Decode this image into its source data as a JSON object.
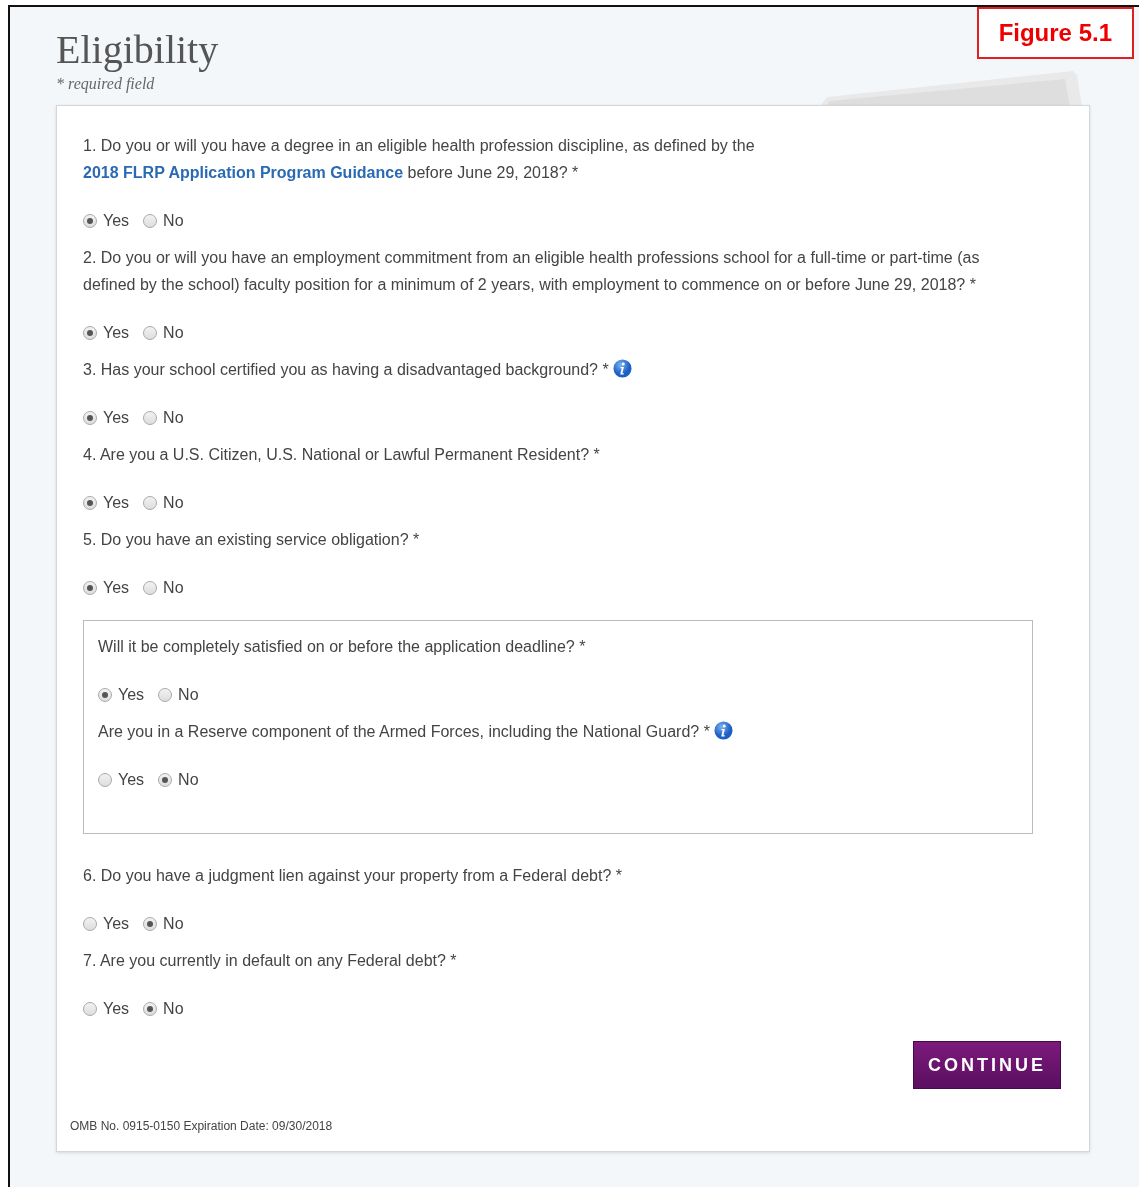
{
  "figure_label": "Figure 5.1",
  "heading": "Eligibility",
  "required_note": "* required field",
  "questions": [
    {
      "text_before": "1. Do you or will you have a degree in an eligible health profession discipline, as defined by the ",
      "link": "2018 FLRP Application Program Guidance",
      "text_after": " before June 29, 2018? *",
      "info": false,
      "options": [
        {
          "label": "Yes",
          "selected": true
        },
        {
          "label": "No",
          "selected": false
        }
      ]
    },
    {
      "text_before": "2. Do you or will you have an employment commitment from an eligible health professions school for a full-time or part-time (as defined by the school) faculty position for a minimum of 2 years, with employment to commence on or before June 29, 2018? *",
      "info": false,
      "options": [
        {
          "label": "Yes",
          "selected": true
        },
        {
          "label": "No",
          "selected": false
        }
      ]
    },
    {
      "text_before": "3. Has your school certified you as having a disadvantaged background? *",
      "info": true,
      "options": [
        {
          "label": "Yes",
          "selected": true
        },
        {
          "label": "No",
          "selected": false
        }
      ]
    },
    {
      "text_before": "4. Are you a U.S. Citizen, U.S. National or Lawful Permanent Resident? *",
      "info": false,
      "options": [
        {
          "label": "Yes",
          "selected": true
        },
        {
          "label": "No",
          "selected": false
        }
      ]
    },
    {
      "text_before": "5. Do you have an existing service obligation? *",
      "info": false,
      "options": [
        {
          "label": "Yes",
          "selected": true
        },
        {
          "label": "No",
          "selected": false
        }
      ],
      "followups": [
        {
          "text_before": "Will it be completely satisfied on or before the application deadline? *",
          "info": false,
          "options": [
            {
              "label": "Yes",
              "selected": true
            },
            {
              "label": "No",
              "selected": false
            }
          ]
        },
        {
          "text_before": "Are you in a Reserve component of the Armed Forces, including the National Guard? *",
          "info": true,
          "options": [
            {
              "label": "Yes",
              "selected": false
            },
            {
              "label": "No",
              "selected": true
            }
          ]
        }
      ]
    },
    {
      "text_before": "6. Do you have a judgment lien against your property from a Federal debt? *",
      "info": false,
      "options": [
        {
          "label": "Yes",
          "selected": false
        },
        {
          "label": "No",
          "selected": true
        }
      ]
    },
    {
      "text_before": "7. Are you currently in default on any Federal debt? *",
      "info": false,
      "options": [
        {
          "label": "Yes",
          "selected": false
        },
        {
          "label": "No",
          "selected": true
        }
      ]
    }
  ],
  "continue_button": "CONTINUE",
  "footer": "OMB No. 0915-0150 Expiration Date: 09/30/2018"
}
